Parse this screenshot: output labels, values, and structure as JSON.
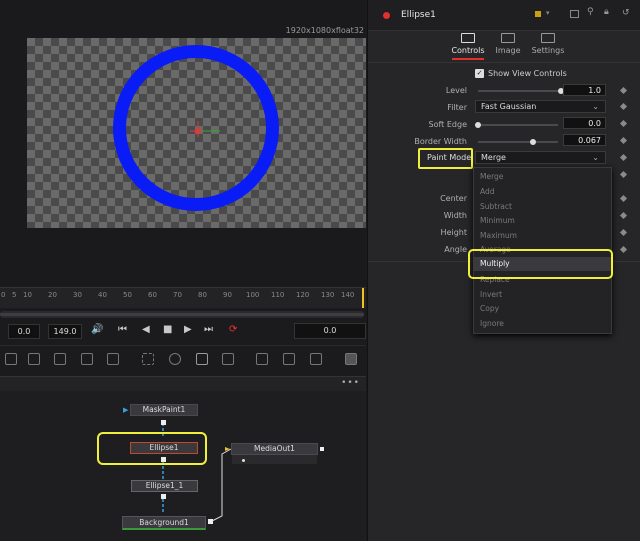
{
  "viewer": {
    "resolution": "1920x1080xfloat32"
  },
  "timeline": {
    "ticks": [
      "0",
      "5",
      "10",
      "20",
      "30",
      "40",
      "50",
      "60",
      "70",
      "80",
      "90",
      "100",
      "110",
      "120",
      "130",
      "140"
    ],
    "current_time": "0.0",
    "end_time": "149.0",
    "frame_display": "0.0"
  },
  "nodes": {
    "maskpaint": "MaskPaint1",
    "ellipse": "Ellipse1",
    "ellipse_1": "Ellipse1_1",
    "background": "Background1",
    "mediaout": "MediaOut1"
  },
  "inspector": {
    "node_name": "Ellipse1",
    "tabs": [
      {
        "label": "Controls"
      },
      {
        "label": "Image"
      },
      {
        "label": "Settings"
      }
    ],
    "show_view_controls": "Show View Controls",
    "level_label": "Level",
    "level_value": "1.0",
    "level_fraction": 1.0,
    "filter_label": "Filter",
    "filter_value": "Fast Gaussian",
    "soft_edge_label": "Soft Edge",
    "soft_edge_value": "0.0",
    "border_width_label": "Border Width",
    "border_width_value": "0.067",
    "paint_mode_label": "Paint Mode",
    "paint_mode_value": "Merge",
    "center_label": "Center",
    "width_label": "Width",
    "height_label": "Height",
    "angle_label": "Angle",
    "menu_items": [
      "Merge",
      "Add",
      "Subtract",
      "Minimum",
      "Maximum",
      "Average",
      "Multiply",
      "Replace",
      "Invert",
      "Copy",
      "Ignore"
    ],
    "menu_selected": "Multiply"
  },
  "colors": {
    "ring": "#0a1cf5",
    "highlight": "#f0f03a",
    "accent_red": "#e0302f"
  }
}
